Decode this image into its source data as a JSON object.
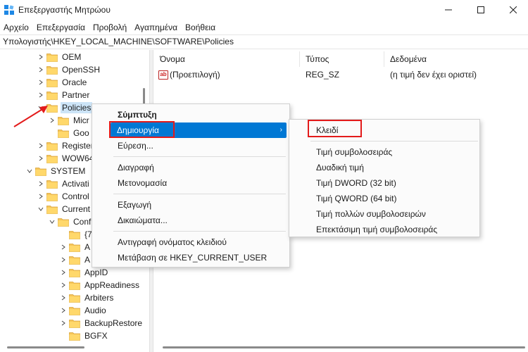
{
  "window": {
    "title": "Επεξεργαστής Μητρώου",
    "icon": "registry-editor-icon",
    "controls": [
      "minimize-icon",
      "maximize-icon",
      "close-icon"
    ]
  },
  "menubar": {
    "items": [
      "Αρχείο",
      "Επεξεργασία",
      "Προβολή",
      "Αγαπημένα",
      "Βοήθεια"
    ]
  },
  "address": {
    "path": "Υπολογιστής\\HKEY_LOCAL_MACHINE\\SOFTWARE\\Policies"
  },
  "tree": {
    "items": [
      {
        "label": "OEM",
        "indent": 3,
        "expander": "collapsed",
        "selected": false
      },
      {
        "label": "OpenSSH",
        "indent": 3,
        "expander": "collapsed",
        "selected": false
      },
      {
        "label": "Oracle",
        "indent": 3,
        "expander": "collapsed",
        "selected": false
      },
      {
        "label": "Partner",
        "indent": 3,
        "expander": "collapsed",
        "selected": false
      },
      {
        "label": "Policies",
        "indent": 3,
        "expander": "expanded",
        "selected": true
      },
      {
        "label": "Micr",
        "indent": 4,
        "expander": "collapsed",
        "selected": false
      },
      {
        "label": "Goo",
        "indent": 4,
        "expander": "none",
        "selected": false
      },
      {
        "label": "Register",
        "indent": 3,
        "expander": "collapsed",
        "selected": false
      },
      {
        "label": "WOW64",
        "indent": 3,
        "expander": "collapsed",
        "selected": false
      },
      {
        "label": "SYSTEM",
        "indent": 2,
        "expander": "expanded",
        "selected": false
      },
      {
        "label": "Activati",
        "indent": 3,
        "expander": "collapsed",
        "selected": false
      },
      {
        "label": "Control",
        "indent": 3,
        "expander": "collapsed",
        "selected": false
      },
      {
        "label": "Current",
        "indent": 3,
        "expander": "expanded",
        "selected": false
      },
      {
        "label": "Conf",
        "indent": 4,
        "expander": "expanded",
        "selected": false
      },
      {
        "label": "{7",
        "indent": 5,
        "expander": "none",
        "selected": false
      },
      {
        "label": "A",
        "indent": 5,
        "expander": "collapsed",
        "selected": false
      },
      {
        "label": "A",
        "indent": 5,
        "expander": "collapsed",
        "selected": false
      },
      {
        "label": "AppID",
        "indent": 5,
        "expander": "collapsed",
        "selected": false
      },
      {
        "label": "AppReadiness",
        "indent": 5,
        "expander": "collapsed",
        "selected": false
      },
      {
        "label": "Arbiters",
        "indent": 5,
        "expander": "collapsed",
        "selected": false
      },
      {
        "label": "Audio",
        "indent": 5,
        "expander": "collapsed",
        "selected": false
      },
      {
        "label": "BackupRestore",
        "indent": 5,
        "expander": "collapsed",
        "selected": false
      },
      {
        "label": "BGFX",
        "indent": 5,
        "expander": "none",
        "selected": false
      }
    ]
  },
  "list": {
    "columns": {
      "name": "Όνομα",
      "type": "Τύπος",
      "data": "Δεδομένα"
    },
    "rows": [
      {
        "icon": "string-value-icon",
        "name": "(Προεπιλογή)",
        "type": "REG_SZ",
        "data": "(η τιμή δεν έχει οριστεί)"
      }
    ]
  },
  "context_menu": {
    "collapse": "Σύμπτυξη",
    "new": "Δημιουργία",
    "find": "Εύρεση...",
    "delete": "Διαγραφή",
    "rename": "Μετονομασία",
    "export": "Εξαγωγή",
    "permissions": "Δικαιώματα...",
    "copy_key_name": "Αντιγραφή ονόματος κλειδιού",
    "goto_hkcu": "Μετάβαση σε HKEY_CURRENT_USER"
  },
  "submenu": {
    "key": "Κλειδί",
    "string_value": "Τιμή συμβολοσειράς",
    "binary_value": "Δυαδική τιμή",
    "dword_value": "Τιμή DWORD (32 bit)",
    "qword_value": "Τιμή QWORD (64 bit)",
    "multi_string_value": "Τιμή πολλών συμβολοσειρών",
    "expandable_string_value": "Επεκτάσιμη τιμή συμβολοσειράς"
  },
  "colors": {
    "highlight": "#0078d4",
    "selection": "#cce4f7",
    "annotation": "#e31b1b",
    "folder": "#f6c55a"
  }
}
